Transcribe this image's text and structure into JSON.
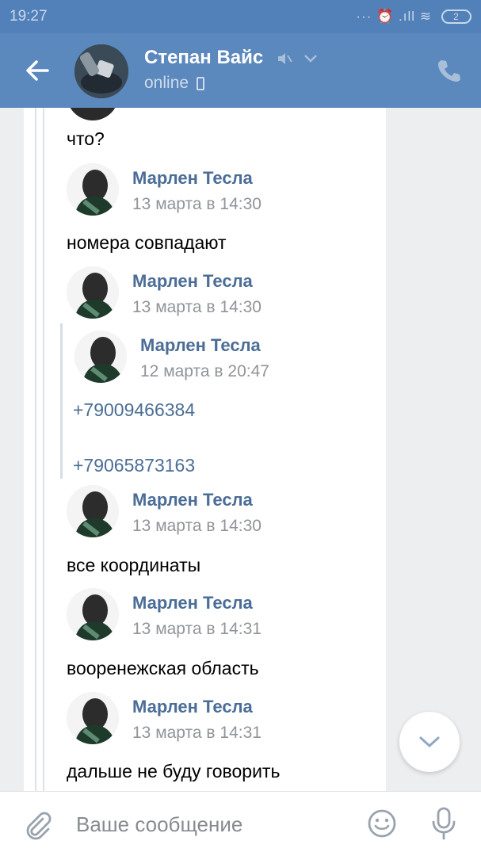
{
  "status_bar": {
    "time": "19:27",
    "icons_text": "··· ⏰ .ıll ≋",
    "battery": "2"
  },
  "header": {
    "contact_name": "Степан Вайс",
    "status": "online",
    "icons": [
      "back-arrow-icon",
      "muted-icon",
      "chevron-down-icon",
      "mobile-icon",
      "phone-icon"
    ]
  },
  "messages": {
    "m0": {
      "text": "что?"
    },
    "m1": {
      "author": "Марлен Тесла",
      "date": "13 марта в 14:30",
      "text": "номера совпадают"
    },
    "m2": {
      "author": "Марлен Тесла",
      "date": "13 марта в 14:30",
      "forward": {
        "author": "Марлен Тесла",
        "date": "12 марта в 20:47",
        "phones": [
          "+79009466384",
          "+79065873163"
        ]
      }
    },
    "m3": {
      "author": "Марлен Тесла",
      "date": "13 марта в 14:30",
      "text": "все координаты"
    },
    "m4": {
      "author": "Марлен Тесла",
      "date": "13 марта в 14:31",
      "text": "вооренежская область"
    },
    "m5": {
      "author": "Марлен Тесла",
      "date": "13 марта в 14:31",
      "text": "дальше не буду говорить"
    }
  },
  "composer": {
    "placeholder": "Ваше сообщение"
  },
  "colors": {
    "header": "#5b88bd",
    "link": "#4b6d96",
    "background": "#edeef0"
  }
}
